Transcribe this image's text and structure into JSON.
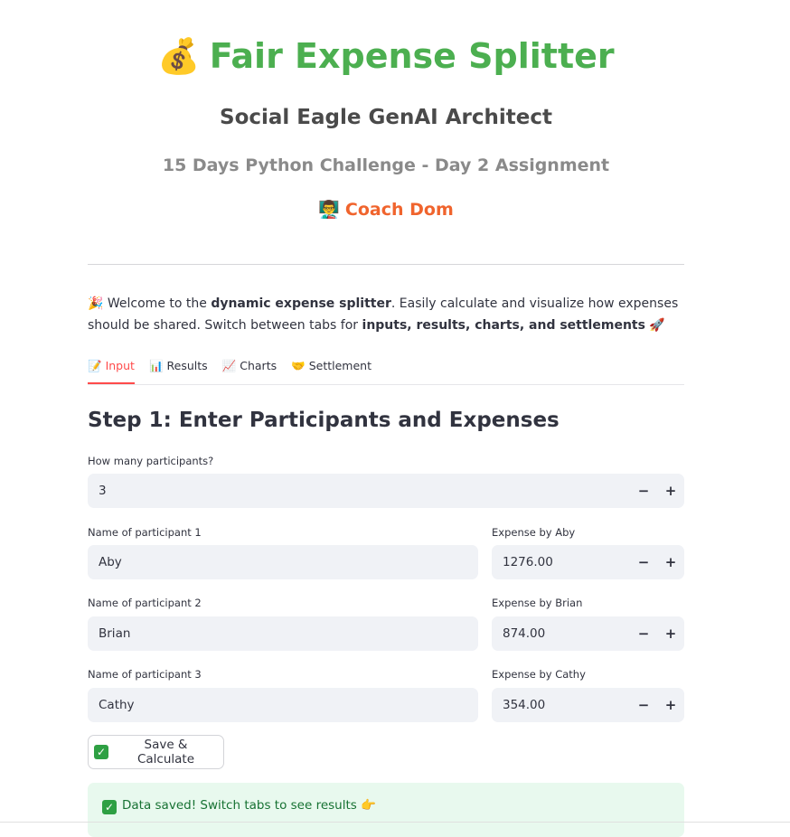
{
  "header": {
    "title_icon": "💰",
    "title": "Fair Expense Splitter",
    "subtitle": "Social Eagle GenAI Architect",
    "subtitle2": "15 Days Python Challenge - Day 2 Assignment",
    "coach_icon": "👨‍🏫",
    "coach": "Coach Dom"
  },
  "intro": {
    "icon": "🎉",
    "text1": "Welcome to the ",
    "bold1": "dynamic expense splitter",
    "text2": ". Easily calculate and visualize how expenses should be shared. Switch between tabs for ",
    "bold2": "inputs, results, charts, and settlements",
    "end_icon": "🚀"
  },
  "tabs": [
    {
      "icon": "📝",
      "label": "Input",
      "active": true
    },
    {
      "icon": "📊",
      "label": "Results",
      "active": false
    },
    {
      "icon": "📈",
      "label": "Charts",
      "active": false
    },
    {
      "icon": "🤝",
      "label": "Settlement",
      "active": false
    }
  ],
  "step_title": "Step 1: Enter Participants and Expenses",
  "participants_count": {
    "label": "How many participants?",
    "value": "3",
    "minus": "−",
    "plus": "+"
  },
  "participants": [
    {
      "name_label": "Name of participant 1",
      "name": "Aby",
      "expense_label": "Expense by Aby",
      "expense": "1276.00"
    },
    {
      "name_label": "Name of participant 2",
      "name": "Brian",
      "expense_label": "Expense by Brian",
      "expense": "874.00"
    },
    {
      "name_label": "Name of participant 3",
      "name": "Cathy",
      "expense_label": "Expense by Cathy",
      "expense": "354.00"
    }
  ],
  "save_button": {
    "check": "✓",
    "label": "Save & Calculate"
  },
  "success": {
    "check": "✓",
    "text": "Data saved! Switch tabs to see results",
    "end_icon": "👉"
  },
  "colors": {
    "title_green": "#4caf50",
    "coach_orange": "#f0642d",
    "tab_active": "#ff4b4b",
    "success_bg": "#e8f9ee",
    "success_text": "#177233"
  }
}
